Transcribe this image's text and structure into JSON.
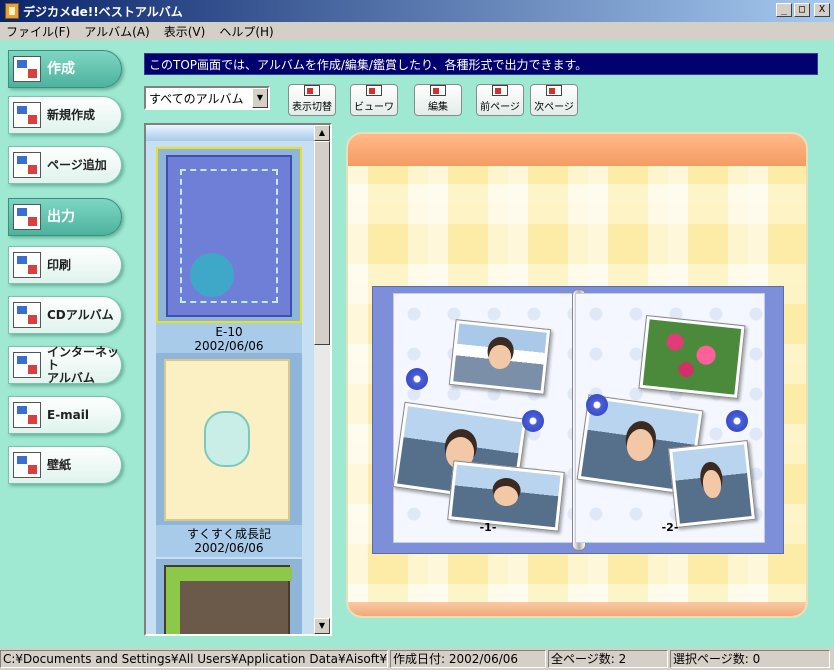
{
  "window": {
    "title": "デジカメde!!ベストアルバム",
    "minimize": "_",
    "maximize": "□",
    "close": "X"
  },
  "menu": [
    "ファイル(F)",
    "アルバム(A)",
    "表示(V)",
    "ヘルプ(H)"
  ],
  "sidebar": {
    "create_section": "作成",
    "new_create": "新規作成",
    "add_page": "ページ追加",
    "output_section": "出力",
    "print": "印刷",
    "cd_album": "CDアルバム",
    "internet_album_line1": "インターネット",
    "internet_album_line2": "アルバム",
    "email": "E-mail",
    "wallpaper": "壁紙"
  },
  "info_text": "このTOP画面では、アルバムを作成/編集/鑑賞したり、各種形式で出力できます。",
  "toolbar": {
    "album_filter": "すべてのアルバム",
    "toggle_view": "表示切替",
    "viewer": "ビューワ",
    "edit": "編集",
    "prev_page": "前ページ",
    "next_page": "次ページ"
  },
  "albums": [
    {
      "name": "E-10",
      "date": "2002/06/06"
    },
    {
      "name": "すくすく成長記",
      "date": "2002/06/06"
    },
    {
      "name": "",
      "date": ""
    }
  ],
  "viewer": {
    "left_page_num": "-1-",
    "right_page_num": "-2-"
  },
  "status": {
    "path": "C:¥Documents and Settings¥All Users¥Application Data¥Aisoft¥AlbumKit¥I",
    "created": "作成日付: 2002/06/06",
    "total_pages": "全ページ数: 2",
    "selected_pages": "選択ページ数: 0"
  },
  "colors": {
    "info_bar": "#00006e",
    "main_background": "#9fe8d2",
    "viewer_header": "#f59b62",
    "book_cover": "#7d8fd8"
  }
}
